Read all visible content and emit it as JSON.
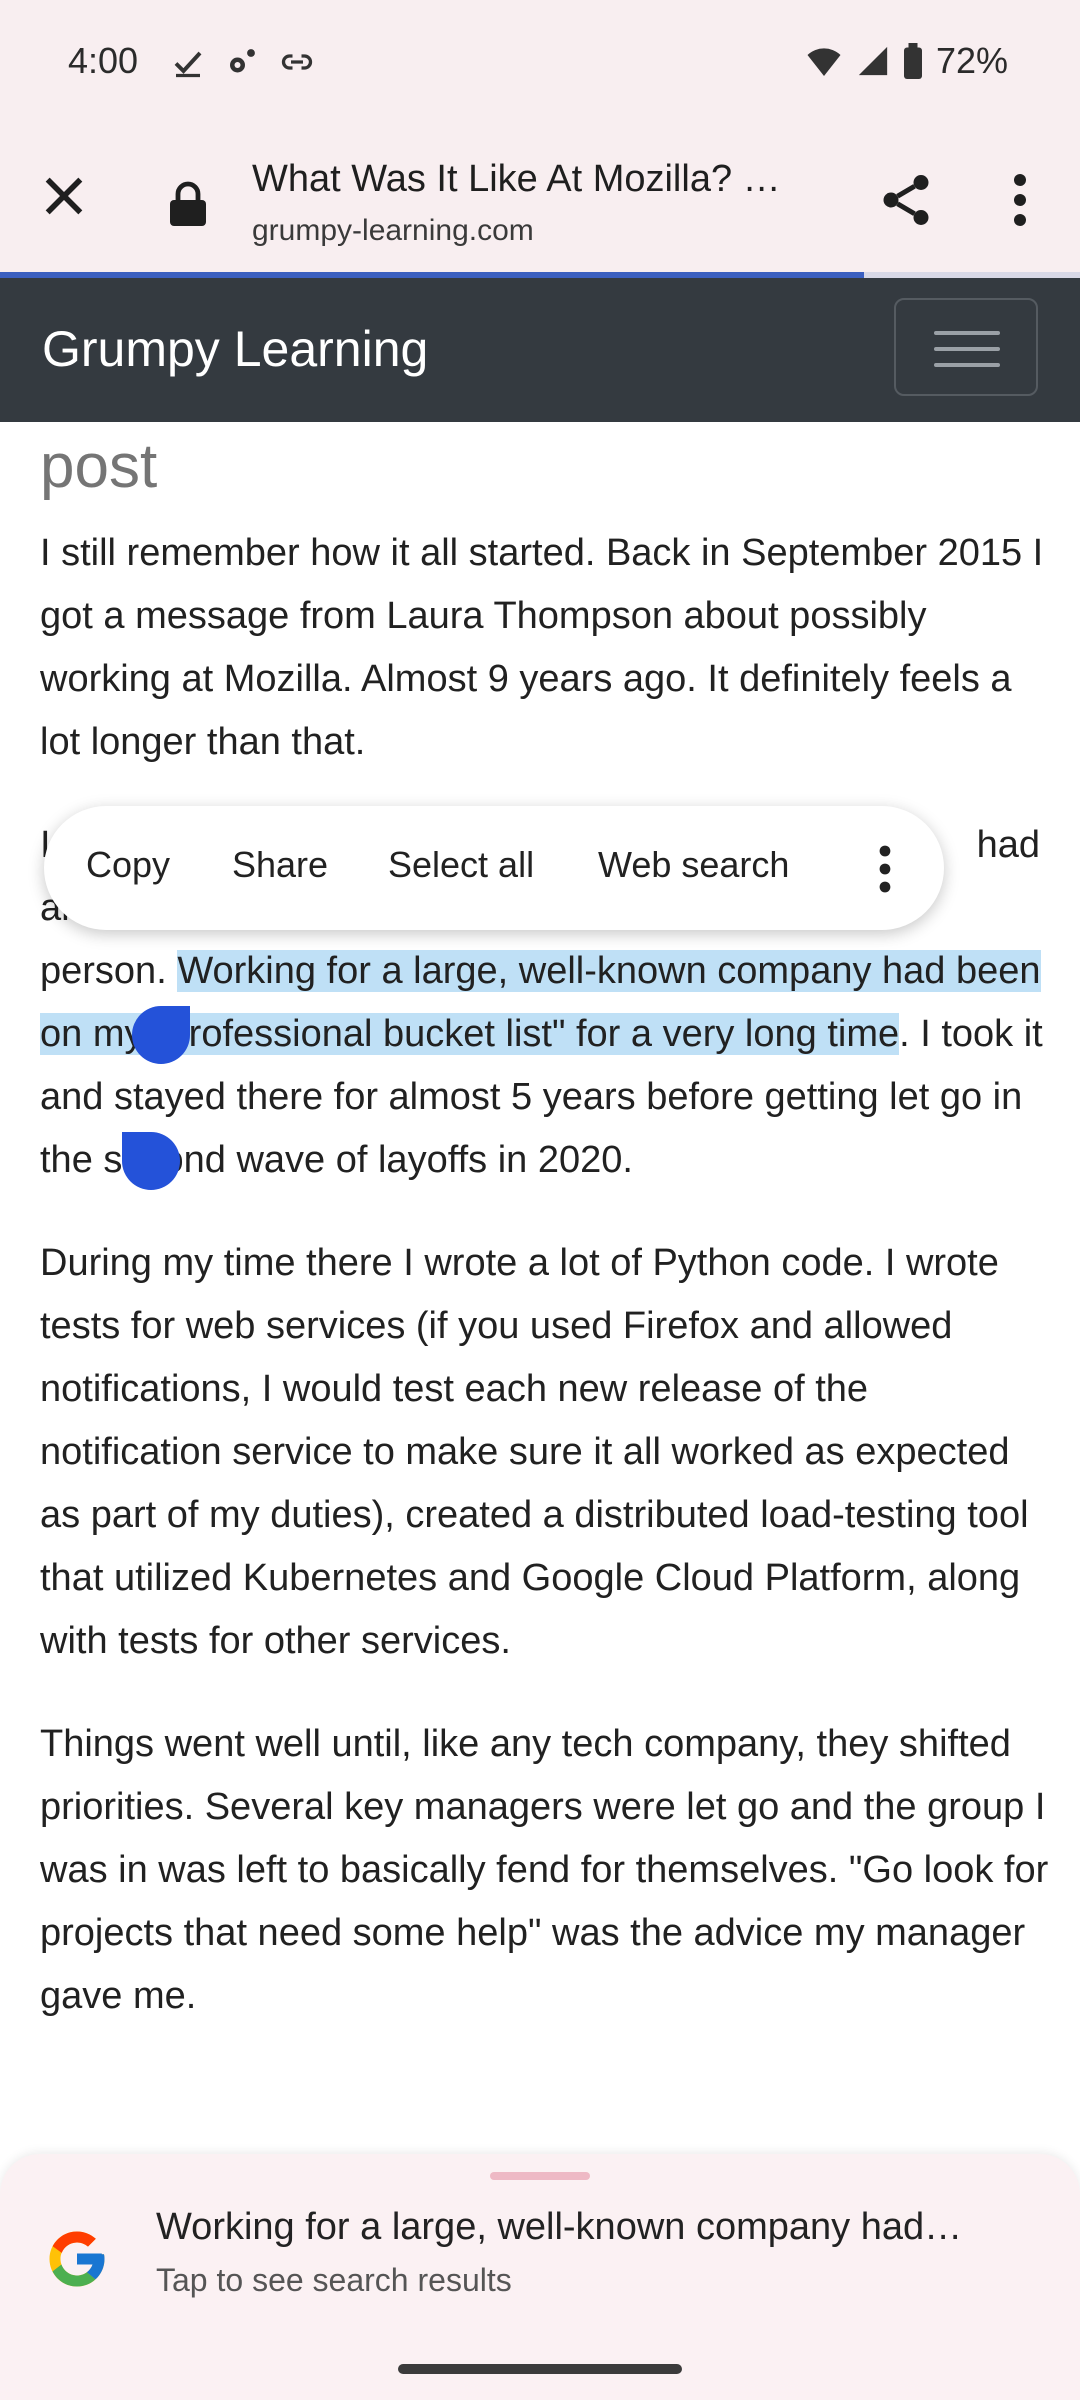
{
  "status_bar": {
    "time": "4:00",
    "battery": "72%",
    "icons_left": [
      "check-icon",
      "settings-dots-icon",
      "link-icon"
    ],
    "icons_right": [
      "wifi-icon",
      "signal-icon",
      "battery-icon"
    ]
  },
  "browser": {
    "page_title": "What Was It Like At Mozilla? …",
    "url": "grumpy-learning.com",
    "load_progress": 0.8
  },
  "site": {
    "brand": "Grumpy Learning"
  },
  "article": {
    "heading_fragment": "post",
    "p1": "I still remember how it all started. Back in September 2015 I got a message from Laura Thompson about possibly working at Mozilla. Almost 9 years ago. It definitely feels a lot longer than that.",
    "p2_line1": "I",
    "p2_line1_end": "had",
    "p2_line2": "an",
    "p2_pre": "person. ",
    "p2_selected": "Working for a large, well-known company had been on my \"professional bucket list\" for a very long time",
    "p2_post": ". I took it and stayed there for almost 5 years before getting let go in the second wave of layoffs in 2020.",
    "p3": "During my time there I wrote a lot of Python code. I wrote tests for web services (if you used Firefox and allowed notifications, I would test each new release of the notification service to make sure it all worked as expected as part of my duties), created a distributed load-testing tool that utilized Kubernetes and Google Cloud Platform, along with tests for other services.",
    "p4": "Things went well until, like any tech company, they shifted priorities. Several key managers were let go and the group I was in was left to basically fend for themselves. \"Go look for projects that need some help\" was the advice my manager gave me."
  },
  "text_actions": {
    "copy": "Copy",
    "share": "Share",
    "select_all": "Select all",
    "web_search": "Web search"
  },
  "search_sheet": {
    "query": "Working for a large, well-known company had…",
    "subtitle": "Tap to see search results"
  }
}
